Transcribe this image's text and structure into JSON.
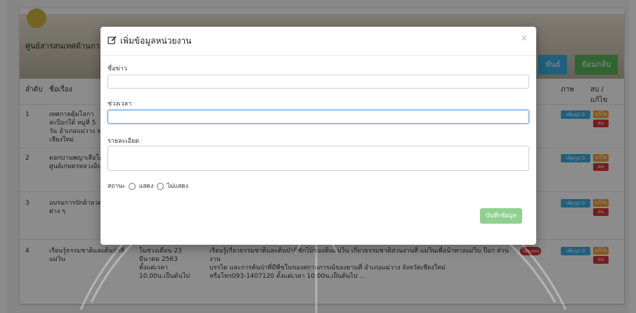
{
  "page": {
    "header_title": "ศูนย์สารสนเทศด้านการ",
    "buttons": {
      "relations": "พันธ์",
      "back": "ย้อนกลับ"
    }
  },
  "table": {
    "headers": [
      "ลำดับ",
      "ชื่อเรื่อง",
      "ภาพ",
      "ลบ /\nแก้ไข"
    ],
    "rows": [
      {
        "number": "1",
        "title_lines": [
          "เทศกาลตุ้มโลกา",
          "สะป๊อกใต้ หมู่ที่ 5",
          "วัน อำเภอแม่วาง จ",
          "เชียงใหม่"
        ],
        "image_btn": "เพิ่มรูป",
        "image_count": "0"
      },
      {
        "number": "2",
        "title_lines": [
          "ดอกบานพญาเสือโคร่ง",
          "ศูนย์เกษตรหลวงอินทนนท์"
        ],
        "image_btn": "เพิ่มรูป",
        "image_count": "0"
      },
      {
        "number": "3",
        "title_lines": [
          "อบรมการปักผ้าลวดลาย",
          "ต่าง ๆ"
        ],
        "image_btn": "เพิ่มรูป",
        "image_count": "0"
      },
      {
        "number": "4",
        "title_lines": [
          "เรียนรู้ธรรมชาติและต้นป่าที่",
          "แม่วิน"
        ],
        "date_lines": [
          "ในช่วงเดือน 23",
          "มีนาคม 2563",
          "ตั้งแต่เวลา",
          "10.00น.เป็นต้นไป"
        ],
        "detail_lines": [
          "เรียนรู้เกี่ยวธรรมชาติและต้นป่าที่ชักไม้ของดินแม่วิน เกี่ยวธรรมชาติส่วนงานที่ แม่วินเพื่อนำทางแม่วิน ป๊อก ส่วนงาน",
          "บรรได และการต้นป่าที่มีพืชในของสถานการณ์ของยานที่ อำเภอแม่วาง จังหวัดเชียงใหม่",
          "หรือโทร093-1407120 ตั้งแต่เวลา 10.00น.เป็นต้นไป ..."
        ],
        "status_badge": "ไม่แสดง",
        "image_btn": "เพิ่มรูป",
        "image_count": "0"
      }
    ],
    "edit_label": "แก้ไข",
    "delete_label": "ลบ"
  },
  "modal": {
    "title": "เพิ่มข้อมูลหน่วยงาน",
    "close": "×",
    "fields": {
      "title_label": "ชื่อข่าว",
      "time_label": "ช่วงเวลา",
      "detail_label": "รายละเอียด"
    },
    "status": {
      "label": "สถานะ",
      "show": "แสดง",
      "hide": "ไม่แสดง"
    },
    "save_button": "บันทึกข้อมูล"
  },
  "colors": {
    "blue": "#3ab0e6",
    "green": "#5ab55e",
    "red": "#d33a3a",
    "orange": "#f0a33a"
  }
}
